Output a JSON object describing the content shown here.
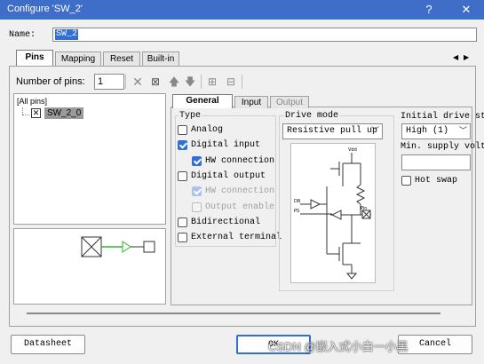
{
  "window": {
    "title": "Configure 'SW_2'",
    "help": "?",
    "close": "✕"
  },
  "name": {
    "label": "Name:",
    "value": "SW_2"
  },
  "tabs": [
    "Pins",
    "Mapping",
    "Reset",
    "Built-in"
  ],
  "tab_scroll": {
    "left": "◀",
    "right": "▶"
  },
  "pins": {
    "count_label": "Number of pins:",
    "count_value": "1",
    "tree_root": "[All pins]",
    "tree_item": "SW_2_0"
  },
  "subtabs": [
    "General",
    "Input",
    "Output"
  ],
  "type": {
    "heading": "Type",
    "analog": "Analog",
    "digital_input": "Digital input",
    "hw_connection_in": "HW connection",
    "digital_output": "Digital output",
    "hw_connection_out": "HW connection",
    "output_enable": "Output enable",
    "bidirectional": "Bidirectional",
    "external_terminal": "External terminal"
  },
  "drive_mode": {
    "heading": "Drive mode",
    "value": "Resistive pull up",
    "diagram": {
      "vdd": "Vdd",
      "dr": "DR",
      "ps": "PS",
      "pin": "Pin"
    }
  },
  "initial_drive": {
    "heading": "Initial drive st",
    "value": "High (1)"
  },
  "min_supply": {
    "heading": "Min. supply volt",
    "value": ""
  },
  "hot_swap": "Hot swap",
  "buttons": {
    "datasheet": "Datasheet",
    "ok": "OK",
    "cancel": "Cancel"
  },
  "watermark": "CSDN @嵌入式小白一小黑",
  "colors": {
    "titlebar": "#3f6ec9",
    "accent": "#2f6fd6",
    "selection": "#9a9a9a",
    "wire": "#2bb52b"
  }
}
